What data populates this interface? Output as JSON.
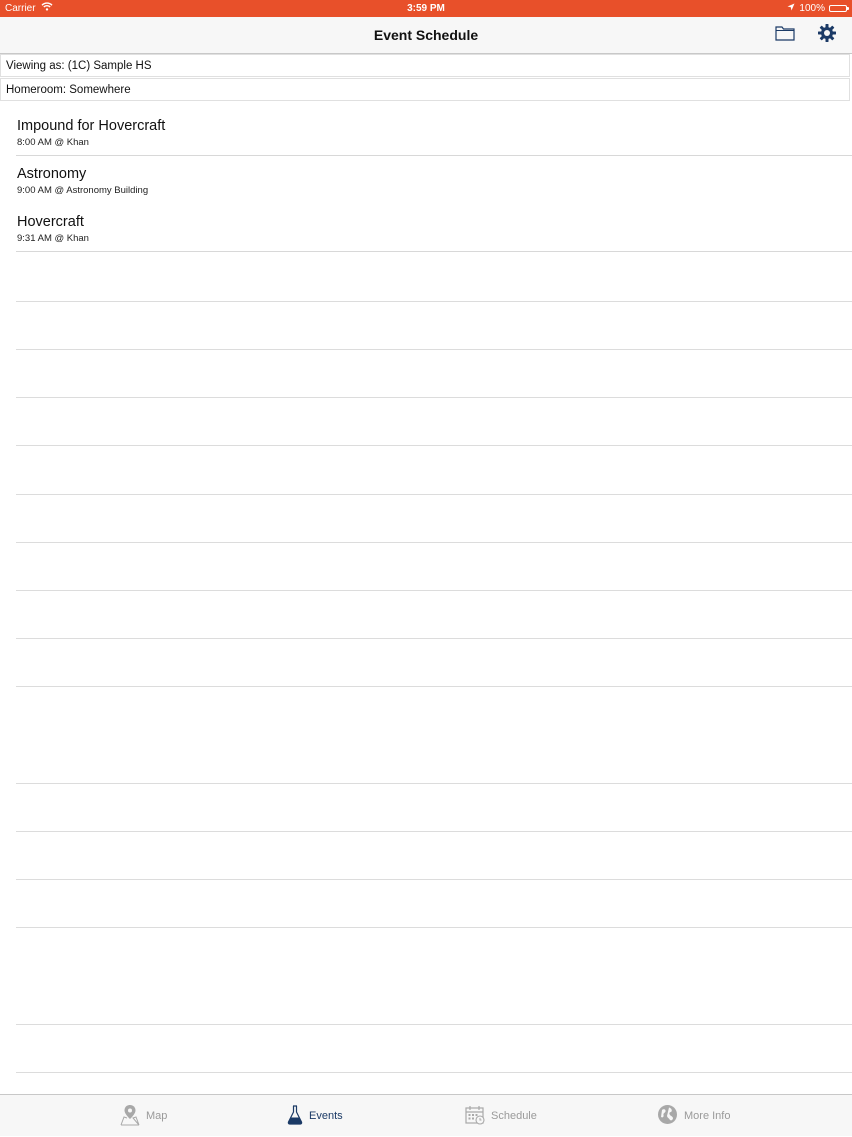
{
  "status_bar": {
    "carrier": "Carrier",
    "time": "3:59 PM",
    "battery": "100%",
    "color": "#e8502a"
  },
  "nav": {
    "title": "Event Schedule",
    "folder_icon": "folder-icon",
    "settings_icon": "gear-icon",
    "icon_color": "#1b3a66"
  },
  "info": {
    "viewing_as": "Viewing as: (1C) Sample HS",
    "homeroom": "Homeroom: Somewhere"
  },
  "events": [
    {
      "title": "Impound for Hovercraft",
      "detail": "8:00 AM @ Khan"
    },
    {
      "title": "Astronomy",
      "detail": "9:00 AM @ Astronomy Building"
    },
    {
      "title": "Hovercraft",
      "detail": "9:31 AM @ Khan"
    }
  ],
  "tabs": [
    {
      "label": "Map",
      "icon": "map-pin-icon",
      "active": false
    },
    {
      "label": "Events",
      "icon": "flask-icon",
      "active": true
    },
    {
      "label": "Schedule",
      "icon": "calendar-icon",
      "active": false
    },
    {
      "label": "More Info",
      "icon": "globe-icon",
      "active": false
    }
  ]
}
